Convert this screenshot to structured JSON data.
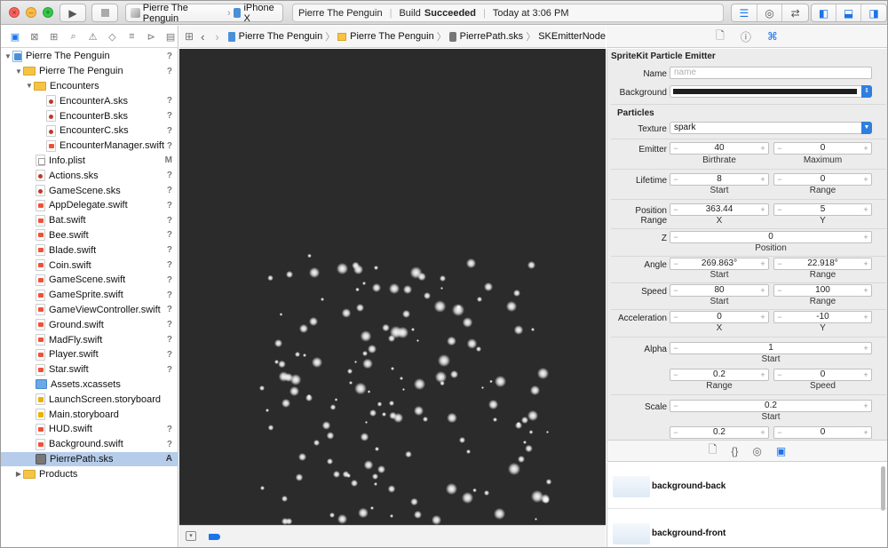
{
  "toolbar": {
    "scheme_target": "Pierre The Penguin",
    "scheme_device": "iPhone X",
    "status_project": "Pierre The Penguin",
    "status_build_prefix": "Build",
    "status_build_result": "Succeeded",
    "status_time": "Today at 3:06 PM"
  },
  "navigator": {
    "items": [
      {
        "label": "Pierre The Penguin",
        "badge": "?"
      },
      {
        "label": "Pierre The Penguin",
        "badge": "?"
      },
      {
        "label": "Encounters",
        "badge": ""
      },
      {
        "label": "EncounterA.sks",
        "badge": "?"
      },
      {
        "label": "EncounterB.sks",
        "badge": "?"
      },
      {
        "label": "EncounterC.sks",
        "badge": "?"
      },
      {
        "label": "EncounterManager.swift",
        "badge": "?"
      },
      {
        "label": "Info.plist",
        "badge": "M"
      },
      {
        "label": "Actions.sks",
        "badge": "?"
      },
      {
        "label": "GameScene.sks",
        "badge": "?"
      },
      {
        "label": "AppDelegate.swift",
        "badge": "?"
      },
      {
        "label": "Bat.swift",
        "badge": "?"
      },
      {
        "label": "Bee.swift",
        "badge": "?"
      },
      {
        "label": "Blade.swift",
        "badge": "?"
      },
      {
        "label": "Coin.swift",
        "badge": "?"
      },
      {
        "label": "GameScene.swift",
        "badge": "?"
      },
      {
        "label": "GameSprite.swift",
        "badge": "?"
      },
      {
        "label": "GameViewController.swift",
        "badge": "?"
      },
      {
        "label": "Ground.swift",
        "badge": "?"
      },
      {
        "label": "MadFly.swift",
        "badge": "?"
      },
      {
        "label": "Player.swift",
        "badge": "?"
      },
      {
        "label": "Star.swift",
        "badge": "?"
      },
      {
        "label": "Assets.xcassets",
        "badge": ""
      },
      {
        "label": "LaunchScreen.storyboard",
        "badge": ""
      },
      {
        "label": "Main.storyboard",
        "badge": ""
      },
      {
        "label": "HUD.swift",
        "badge": "?"
      },
      {
        "label": "Background.swift",
        "badge": "?"
      },
      {
        "label": "PierrePath.sks",
        "badge": "A"
      },
      {
        "label": "Products",
        "badge": ""
      }
    ]
  },
  "jumpbar": {
    "crumb1": "Pierre The Penguin",
    "crumb2": "Pierre The Penguin",
    "crumb3": "PierrePath.sks",
    "crumb4": "SKEmitterNode"
  },
  "inspector": {
    "title": "SpriteKit Particle Emitter",
    "name_label": "Name",
    "name_placeholder": "name",
    "background_label": "Background",
    "background_color": "#1e1e1e",
    "particles_heading": "Particles",
    "texture_label": "Texture",
    "texture_value": "spark",
    "emitter": {
      "label": "Emitter",
      "birthrate": "40",
      "maximum": "0",
      "birthrate_label": "Birthrate",
      "maximum_label": "Maximum"
    },
    "lifetime": {
      "label": "Lifetime",
      "start": "8",
      "range": "0",
      "start_label": "Start",
      "range_label": "Range"
    },
    "position_range": {
      "label": "Position Range",
      "x": "363.44",
      "y": "5",
      "x_label": "X",
      "y_label": "Y"
    },
    "z": {
      "label": "Z",
      "position": "0",
      "position_label": "Position"
    },
    "angle": {
      "label": "Angle",
      "start": "269.863°",
      "range": "22.918°",
      "start_label": "Start",
      "range_label": "Range"
    },
    "speed": {
      "label": "Speed",
      "start": "80",
      "range": "100",
      "start_label": "Start",
      "range_label": "Range"
    },
    "acceleration": {
      "label": "Acceleration",
      "x": "0",
      "y": "-10",
      "x_label": "X",
      "y_label": "Y"
    },
    "alpha": {
      "label": "Alpha",
      "start": "1",
      "start_label": "Start",
      "range": "0.2",
      "speed": "0",
      "range_label": "Range",
      "speed_label": "Speed"
    },
    "scale": {
      "label": "Scale",
      "start": "0.2",
      "start_label": "Start",
      "range": "0.2",
      "speed": "0"
    }
  },
  "library": {
    "items": [
      {
        "label": "background-back"
      },
      {
        "label": "background-front"
      }
    ]
  }
}
